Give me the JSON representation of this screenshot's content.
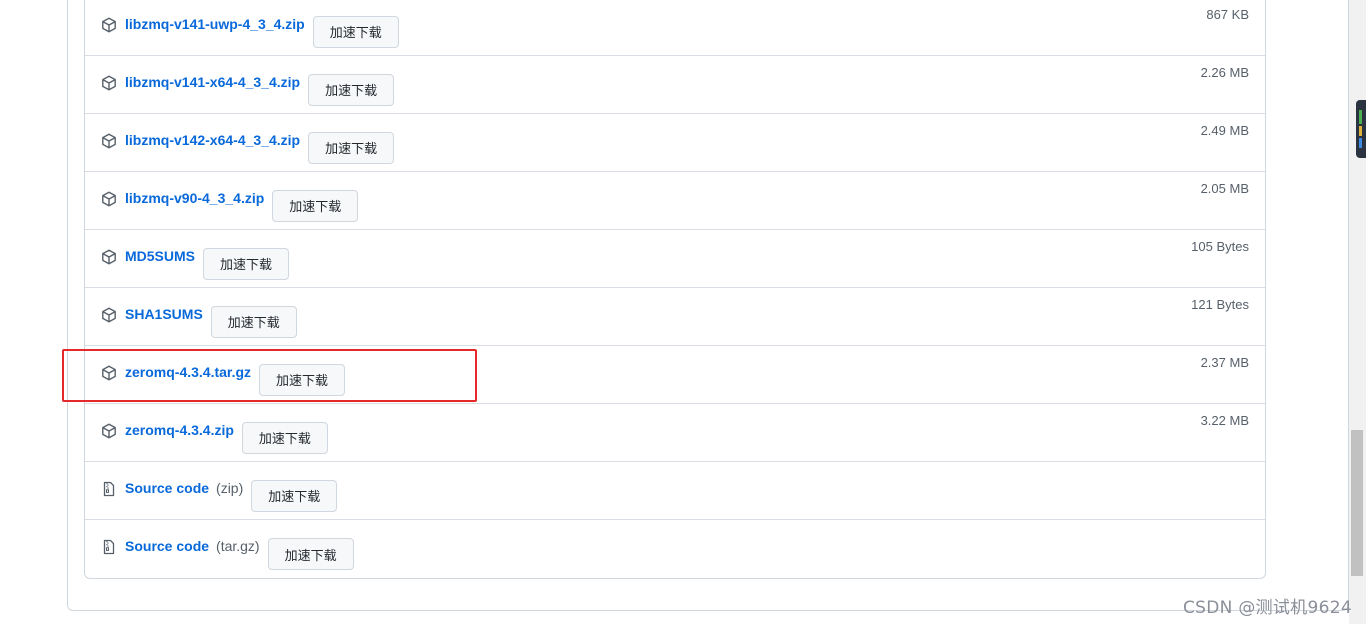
{
  "assets": [
    {
      "name": "libzmq-v141-uwp-4_3_4.zip",
      "ext": "",
      "button": "加速下载",
      "size": "867 KB",
      "icon": "package-icon"
    },
    {
      "name": "libzmq-v141-x64-4_3_4.zip",
      "ext": "",
      "button": "加速下载",
      "size": "2.26 MB",
      "icon": "package-icon"
    },
    {
      "name": "libzmq-v142-x64-4_3_4.zip",
      "ext": "",
      "button": "加速下载",
      "size": "2.49 MB",
      "icon": "package-icon"
    },
    {
      "name": "libzmq-v90-4_3_4.zip",
      "ext": "",
      "button": "加速下载",
      "size": "2.05 MB",
      "icon": "package-icon"
    },
    {
      "name": "MD5SUMS",
      "ext": "",
      "button": "加速下载",
      "size": "105 Bytes",
      "icon": "package-icon"
    },
    {
      "name": "SHA1SUMS",
      "ext": "",
      "button": "加速下载",
      "size": "121 Bytes",
      "icon": "package-icon"
    },
    {
      "name": "zeromq-4.3.4.tar.gz",
      "ext": "",
      "button": "加速下载",
      "size": "2.37 MB",
      "icon": "package-icon",
      "highlighted": true
    },
    {
      "name": "zeromq-4.3.4.zip",
      "ext": "",
      "button": "加速下载",
      "size": "3.22 MB",
      "icon": "package-icon"
    },
    {
      "name": "Source code",
      "ext": "(zip)",
      "button": "加速下载",
      "size": "",
      "icon": "file-zip-icon"
    },
    {
      "name": "Source code",
      "ext": "(tar.gz)",
      "button": "加速下载",
      "size": "",
      "icon": "file-zip-icon"
    }
  ],
  "watermark": "CSDN @测试机9624",
  "colors": {
    "link": "#0969da",
    "highlight": "#e5292b",
    "border": "#d0d7de"
  }
}
